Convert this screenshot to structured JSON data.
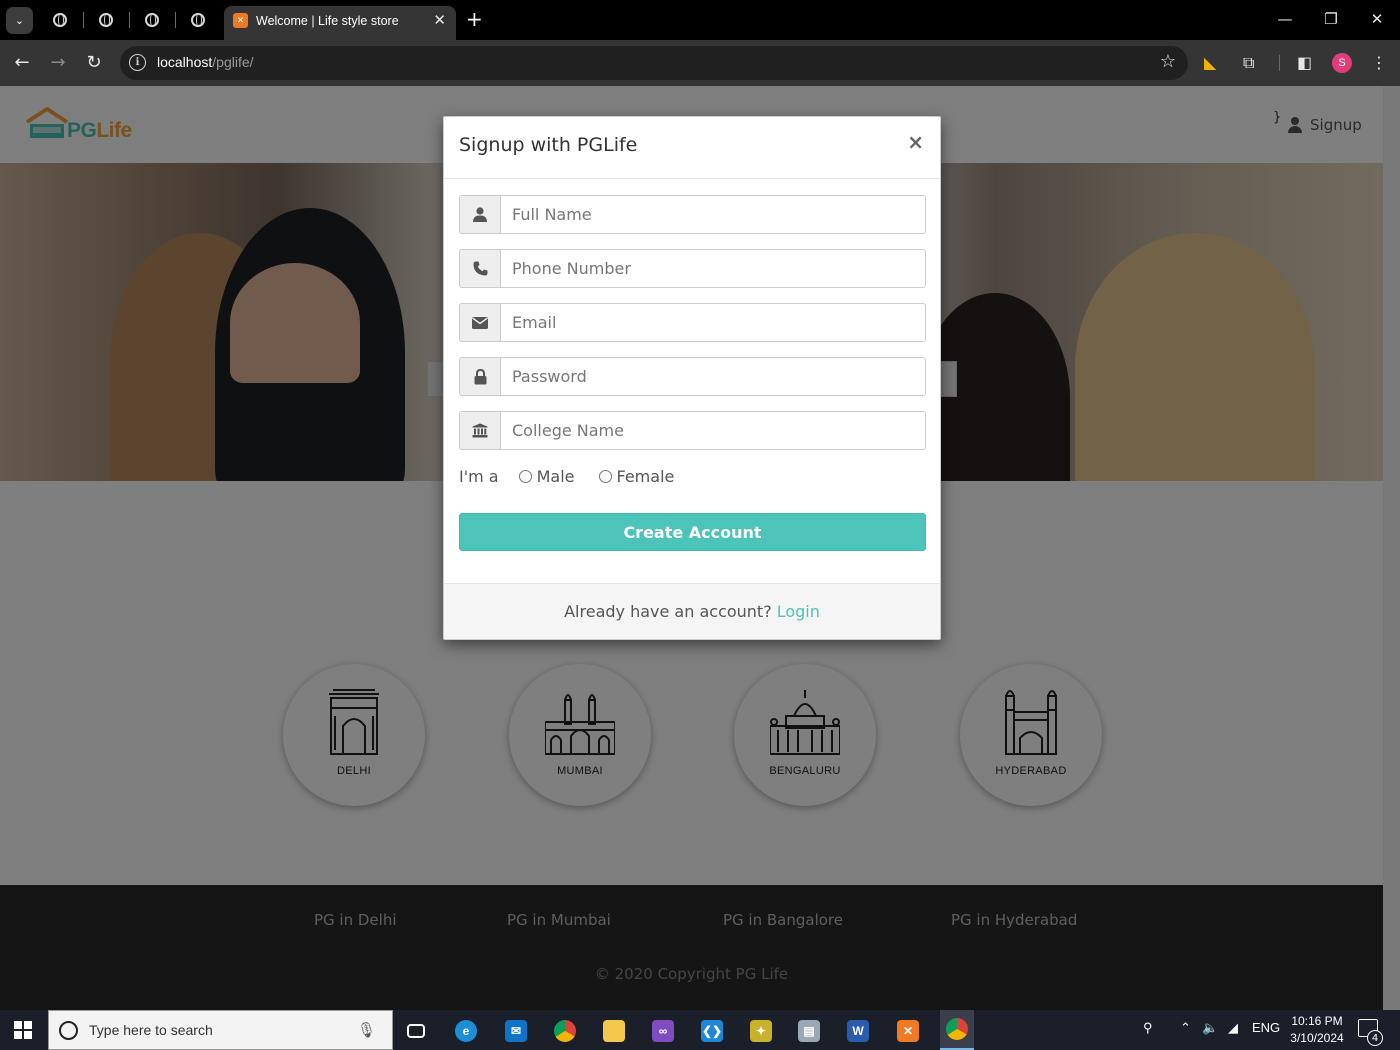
{
  "browser": {
    "tab_title": "Welcome | Life style store",
    "url_host": "localhost",
    "url_path": "/pglife/",
    "profile_initial": "S"
  },
  "header": {
    "logo_pg": "PG",
    "logo_life": "Life",
    "brace": "}",
    "signup_label": "Signup"
  },
  "cities": [
    {
      "label": "DELHI"
    },
    {
      "label": "MUMBAI"
    },
    {
      "label": "BENGALURU"
    },
    {
      "label": "HYDERABAD"
    }
  ],
  "footer": {
    "links": [
      "PG in Delhi",
      "PG in Mumbai",
      "PG in Bangalore",
      "PG in Hyderabad"
    ],
    "copyright": "© 2020 Copyright PG Life"
  },
  "modal": {
    "title": "Signup with PGLife",
    "close": "×",
    "fields": {
      "full_name": "Full Name",
      "phone": "Phone Number",
      "email": "Email",
      "password": "Password",
      "college": "College Name"
    },
    "gender_prompt": "I'm a",
    "gender_options": [
      "Male",
      "Female"
    ],
    "submit_label": "Create Account",
    "footer_text": "Already have an account?",
    "login_link": "Login"
  },
  "taskbar": {
    "search_placeholder": "Type here to search",
    "language": "ENG",
    "time": "10:16 PM",
    "date": "3/10/2024",
    "notification_count": "4"
  },
  "colors": {
    "accent": "#4cc4b9",
    "logo_orange": "#f1a33d",
    "footer_bg": "#2b2b2b",
    "overlay": "rgba(0,0,0,0.5)"
  }
}
